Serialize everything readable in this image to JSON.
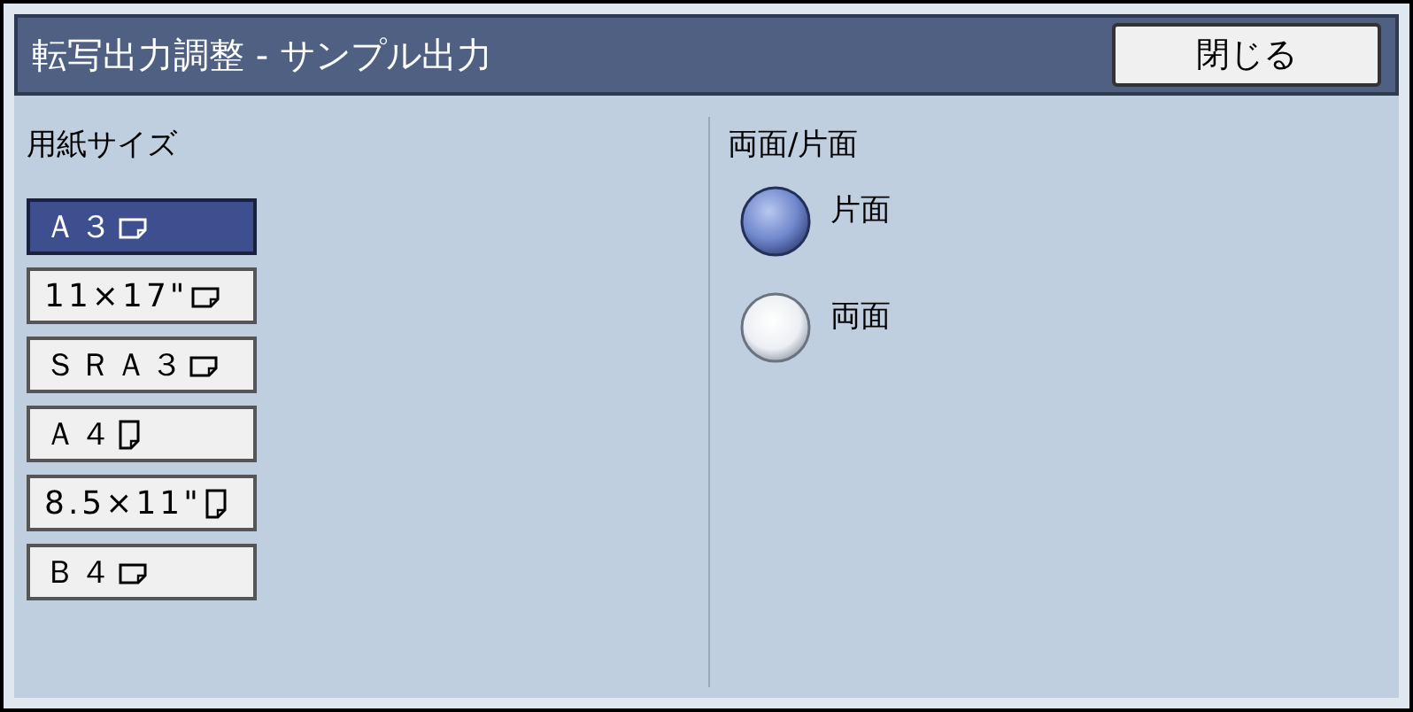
{
  "window": {
    "title": "転写出力調整 - サンプル出力"
  },
  "close_button": {
    "label": "閉じる"
  },
  "paper_size": {
    "heading": "用紙サイズ",
    "options": [
      {
        "label": "Ａ３",
        "kind": "landscape",
        "selected": true
      },
      {
        "label": "11×17\"",
        "kind": "landscape",
        "selected": false
      },
      {
        "label": "ＳＲＡ３",
        "kind": "landscape",
        "selected": false
      },
      {
        "label": "Ａ４",
        "kind": "portrait",
        "selected": false
      },
      {
        "label": "8.5×11\"",
        "kind": "portrait",
        "selected": false
      },
      {
        "label": "Ｂ４",
        "kind": "landscape",
        "selected": false
      }
    ]
  },
  "sides": {
    "heading": "両面/片面",
    "options": [
      {
        "label": "片面",
        "selected": true
      },
      {
        "label": "両面",
        "selected": false
      }
    ]
  }
}
